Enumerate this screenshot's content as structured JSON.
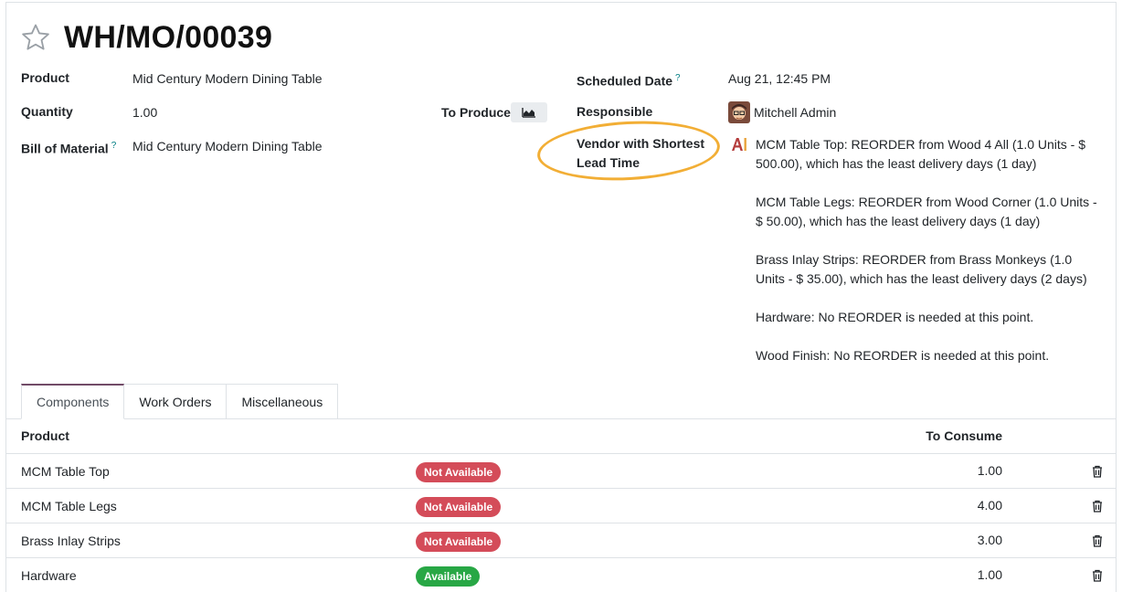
{
  "record": {
    "title": "WH/MO/00039"
  },
  "fields": {
    "product_label": "Product",
    "product_value": "Mid Century Modern Dining Table",
    "quantity_label": "Quantity",
    "quantity_value": "1.00",
    "to_produce_label": "To Produce",
    "bom_label": "Bill of Material",
    "bom_help": "?",
    "bom_value": "Mid Century Modern Dining Table",
    "scheduled_label": "Scheduled Date",
    "scheduled_help": "?",
    "scheduled_value": "Aug 21, 12:45 PM",
    "responsible_label": "Responsible",
    "responsible_value": "Mitchell Admin",
    "vendor_label_line1": "Vendor with Shortest",
    "vendor_label_line2": "Lead Time",
    "vendor_lines": [
      "MCM Table Top: REORDER from Wood 4 All (1.0 Units - $ 500.00), which has the least delivery days (1 day)",
      "MCM Table Legs: REORDER from Wood Corner (1.0 Units - $ 50.00), which has the least delivery days (1 day)",
      "Brass Inlay Strips: REORDER from Brass Monkeys (1.0 Units - $ 35.00), which has the least delivery days (2 days)",
      "Hardware: No REORDER is needed at this point.",
      "Wood Finish: No REORDER is needed at this point."
    ]
  },
  "tabs": [
    {
      "label": "Components"
    },
    {
      "label": "Work Orders"
    },
    {
      "label": "Miscellaneous"
    }
  ],
  "table": {
    "headers": {
      "product": "Product",
      "to_consume": "To Consume"
    },
    "rows": [
      {
        "product": "MCM Table Top",
        "status": "Not Available",
        "to_consume": "1.00"
      },
      {
        "product": "MCM Table Legs",
        "status": "Not Available",
        "to_consume": "4.00"
      },
      {
        "product": "Brass Inlay Strips",
        "status": "Not Available",
        "to_consume": "3.00"
      },
      {
        "product": "Hardware",
        "status": "Available",
        "to_consume": "1.00"
      }
    ]
  },
  "colors": {
    "accent": "#714b67",
    "highlight_circle": "#f2ae35",
    "not_available": "#d44c59",
    "available": "#28a745",
    "help": "#017e84"
  },
  "icons": {
    "favorite": "star-icon",
    "forecast": "area-chart-icon",
    "ai": "ai-icon",
    "delete": "trash-icon"
  }
}
